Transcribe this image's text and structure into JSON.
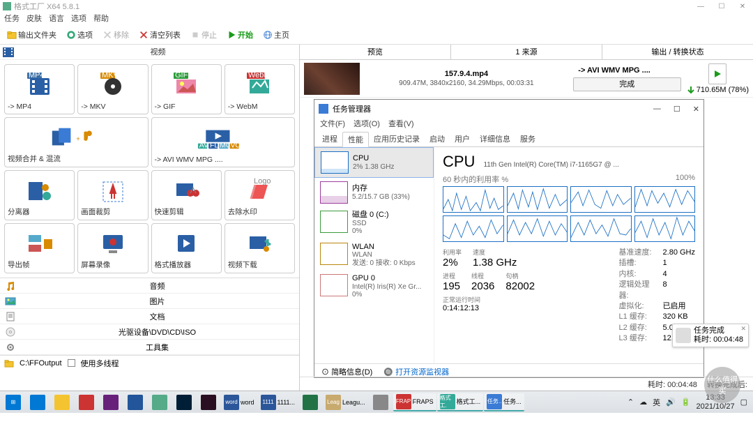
{
  "app": {
    "title": "格式工厂 X64 5.8.1"
  },
  "menu": [
    "任务",
    "皮肤",
    "语言",
    "选项",
    "帮助"
  ],
  "toolbar": {
    "output_folder": "输出文件夹",
    "options": "选项",
    "remove": "移除",
    "clear_list": "清空列表",
    "stop": "停止",
    "start": "开始",
    "homepage": "主页"
  },
  "sections": {
    "video": "视频",
    "audio": "音频",
    "image": "图片",
    "document": "文档",
    "optical": "光驱设备\\DVD\\CD\\ISO",
    "toolkit": "工具集"
  },
  "tiles": [
    {
      "label": "-> MP4",
      "badge": "MP4",
      "bc": "#3b6ea5"
    },
    {
      "label": "-> MKV",
      "badge": "MKV",
      "bc": "#d88a00"
    },
    {
      "label": "-> GIF",
      "badge": "GIF",
      "bc": "#2a9b3a"
    },
    {
      "label": "-> WebM",
      "badge": "WebM",
      "bc": "#c33"
    },
    {
      "label": "视频合并 & 混流",
      "wide": true
    },
    {
      "label": "-> AVI WMV MPG ....",
      "wide": true
    },
    {
      "label": "分离器"
    },
    {
      "label": "画面裁剪"
    },
    {
      "label": "快速剪辑"
    },
    {
      "label": "去除水印"
    },
    {
      "label": "导出帧"
    },
    {
      "label": "屏幕录像"
    },
    {
      "label": "格式播放器"
    },
    {
      "label": "视频下载"
    }
  ],
  "status_left": {
    "path": "C:\\FFOutput",
    "multithread": "使用多线程"
  },
  "right_header": {
    "preview": "预览",
    "source": "1 来源",
    "output": "输出 / 转换状态"
  },
  "job": {
    "filename": "157.9.4.mp4",
    "info": "909.47M, 3840x2160, 34.29Mbps, 00:03:31",
    "target": "-> AVI WMV MPG ....",
    "done": "完成",
    "outsize": "710.65M  (78%)"
  },
  "tm": {
    "title": "任务管理器",
    "menu": [
      "文件(F)",
      "选项(O)",
      "查看(V)"
    ],
    "tabs": [
      "进程",
      "性能",
      "应用历史记录",
      "启动",
      "用户",
      "详细信息",
      "服务"
    ],
    "side": [
      {
        "t": "CPU",
        "s": "2%  1.38 GHz",
        "cls": "cpu"
      },
      {
        "t": "内存",
        "s": "5.2/15.7 GB (33%)",
        "cls": "mem"
      },
      {
        "t": "磁盘 0 (C:)",
        "s": "SSD",
        "s2": "0%",
        "cls": "disk"
      },
      {
        "t": "WLAN",
        "s": "WLAN",
        "s2": "发送: 0 接收: 0 Kbps",
        "cls": "wlan"
      },
      {
        "t": "GPU 0",
        "s": "Intel(R) Iris(R) Xe Gr...",
        "s2": "0%",
        "cls": "gpu"
      }
    ],
    "cpu": {
      "heading": "CPU",
      "model": "11th Gen Intel(R) Core(TM) i7-1165G7 @ ...",
      "graph_label_l": "60 秒内的利用率 %",
      "graph_label_r": "100%",
      "util_lbl": "利用率",
      "util": "2%",
      "speed_lbl": "速度",
      "speed": "1.38 GHz",
      "proc_lbl": "进程",
      "proc": "195",
      "thread_lbl": "线程",
      "thread": "2036",
      "handle_lbl": "句柄",
      "handle": "82002",
      "uptime_lbl": "正常运行时间",
      "uptime": "0:14:12:13",
      "info": [
        {
          "k": "基准速度:",
          "v": "2.80 GHz"
        },
        {
          "k": "插槽:",
          "v": "1"
        },
        {
          "k": "内核:",
          "v": "4"
        },
        {
          "k": "逻辑处理器:",
          "v": "8"
        },
        {
          "k": "虚拟化:",
          "v": "已启用"
        },
        {
          "k": "L1 缓存:",
          "v": "320 KB"
        },
        {
          "k": "L2 缓存:",
          "v": "5.0 MB"
        },
        {
          "k": "L3 缓存:",
          "v": "12.0 MB"
        }
      ]
    },
    "foot": {
      "brief": "简略信息(D)",
      "rm": "打开资源监视器"
    }
  },
  "notif": {
    "title": "任务完成",
    "detail": "耗时: 00:04:48"
  },
  "right_status": {
    "elapsed_lbl": "耗时:",
    "elapsed": "00:04:48",
    "convert_done": "转换完成",
    "after": "转换完成后:"
  },
  "taskbar": {
    "apps": [
      "win",
      "edge",
      "files",
      "fraps",
      "vb",
      "vnc",
      "af",
      "ps",
      "br",
      "word",
      "1111...",
      "xl",
      "Leagu...",
      "ff",
      "FRAPS",
      "格式工...",
      "任务..."
    ],
    "tray": {
      "ime": "英",
      "time": "13:33",
      "date": "2021/10/27"
    }
  },
  "watermark": "什么值得买"
}
